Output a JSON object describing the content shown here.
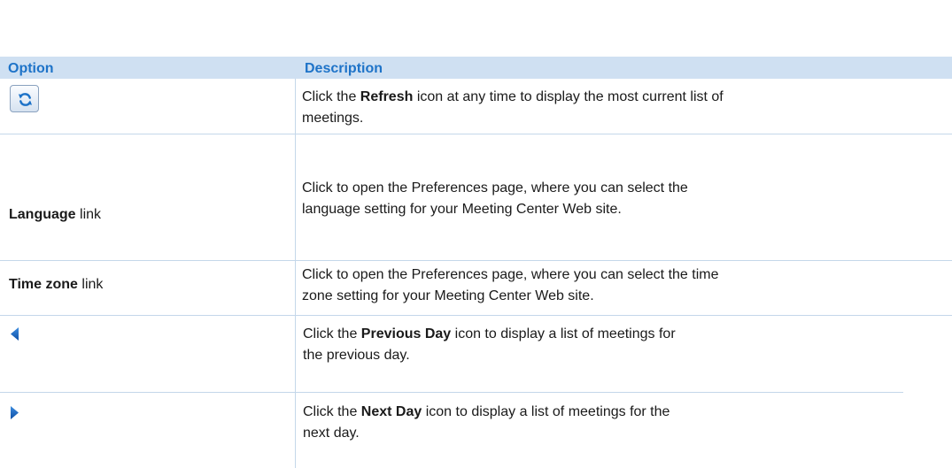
{
  "header": {
    "option": "Option",
    "description": "Description"
  },
  "icons": {
    "refresh": "refresh-icon",
    "previous_day": "previous-day-icon",
    "next_day": "next-day-icon",
    "accent_color": "#1e73c8",
    "header_color": "#cfe0f2"
  },
  "rows": [
    {
      "option_icon": "refresh-icon",
      "desc_pre": "Click the ",
      "desc_bold": "Refresh",
      "desc_line1_post": " icon at any time to display the most current list of",
      "desc_line2": "meetings."
    },
    {
      "option_bold": "Language",
      "option_post": " link",
      "desc_line1": "Click to open the Preferences page, where you can select the",
      "desc_line2": "language setting for your Meeting Center Web site."
    },
    {
      "option_bold": "Time zone",
      "option_post": " link",
      "desc_line1": "Click to open the Preferences page, where you can select the time",
      "desc_line2": "zone setting for your Meeting Center Web site."
    },
    {
      "option_icon": "previous-day-icon",
      "desc_pre": "Click the ",
      "desc_bold": "Previous Day",
      "desc_line1_post": " icon to display a list of meetings for",
      "desc_line2": "the previous day."
    },
    {
      "option_icon": "next-day-icon",
      "desc_pre": "Click the ",
      "desc_bold": "Next Day",
      "desc_line1_post": " icon to display a list of meetings for the",
      "desc_line2": "next day."
    }
  ]
}
